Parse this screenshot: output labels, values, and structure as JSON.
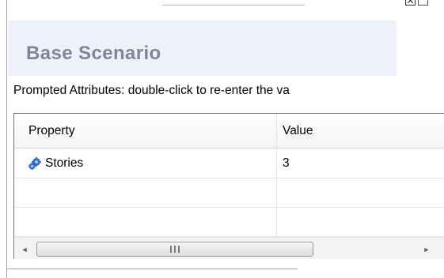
{
  "scenario": {
    "title": "Base Scenario"
  },
  "instructions": "Prompted Attributes: double-click to re-enter the va",
  "table": {
    "columns": [
      "Property",
      "Value"
    ],
    "rows": [
      {
        "property": "Stories",
        "value": "3",
        "icon": "gears-icon"
      },
      {
        "property": "",
        "value": ""
      },
      {
        "property": "",
        "value": ""
      }
    ]
  },
  "scrollbar": {
    "left_arrow": "◄",
    "right_arrow": "►"
  },
  "colors": {
    "title_text": "#7f849a",
    "title_background": "#eef1fa",
    "icon_blue": "#2f6fc8"
  }
}
